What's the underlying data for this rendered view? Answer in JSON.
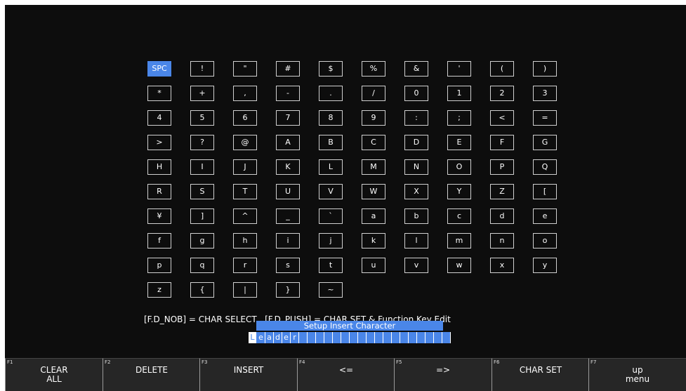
{
  "keys": [
    "SPC",
    "!",
    "\"",
    "#",
    "$",
    "%",
    "&",
    "'",
    "(",
    ")",
    "*",
    "+",
    ",",
    "-",
    ".",
    "/",
    "0",
    "1",
    "2",
    "3",
    "4",
    "5",
    "6",
    "7",
    "8",
    "9",
    ":",
    ";",
    "<",
    "=",
    ">",
    "?",
    "@",
    "A",
    "B",
    "C",
    "D",
    "E",
    "F",
    "G",
    "H",
    "I",
    "J",
    "K",
    "L",
    "M",
    "N",
    "O",
    "P",
    "Q",
    "R",
    "S",
    "T",
    "U",
    "V",
    "W",
    "X",
    "Y",
    "Z",
    "[",
    "¥",
    "]",
    "^",
    "_",
    "`",
    "a",
    "b",
    "c",
    "d",
    "e",
    "f",
    "g",
    "h",
    "i",
    "j",
    "k",
    "l",
    "m",
    "n",
    "o",
    "p",
    "q",
    "r",
    "s",
    "t",
    "u",
    "v",
    "w",
    "x",
    "y",
    "z",
    "{",
    "|",
    "}",
    "~"
  ],
  "selected_key": "SPC",
  "hint_text": "[F.D_NOB] = CHAR SELECT , [F.D_PUSH] = CHAR SET & Function Key Edit",
  "dialog": {
    "title": "Setup Insert Character",
    "chars": [
      "L",
      "e",
      "a",
      "d",
      "e",
      "r",
      "",
      "",
      "",
      "",
      "",
      "",
      "",
      "",
      "",
      "",
      "",
      "",
      "",
      "",
      "",
      "",
      "",
      ""
    ]
  },
  "function_keys": [
    {
      "num": "F1",
      "label": "CLEAR\nALL"
    },
    {
      "num": "F2",
      "label": "DELETE"
    },
    {
      "num": "F3",
      "label": "INSERT"
    },
    {
      "num": "F4",
      "label": "<="
    },
    {
      "num": "F5",
      "label": "=>"
    },
    {
      "num": "F6",
      "label": "CHAR SET"
    },
    {
      "num": "F7",
      "label": "up\nmenu"
    }
  ],
  "colors": {
    "accent": "#4a86e8",
    "background": "#0d0d0d",
    "fkey_bg": "#262626"
  }
}
